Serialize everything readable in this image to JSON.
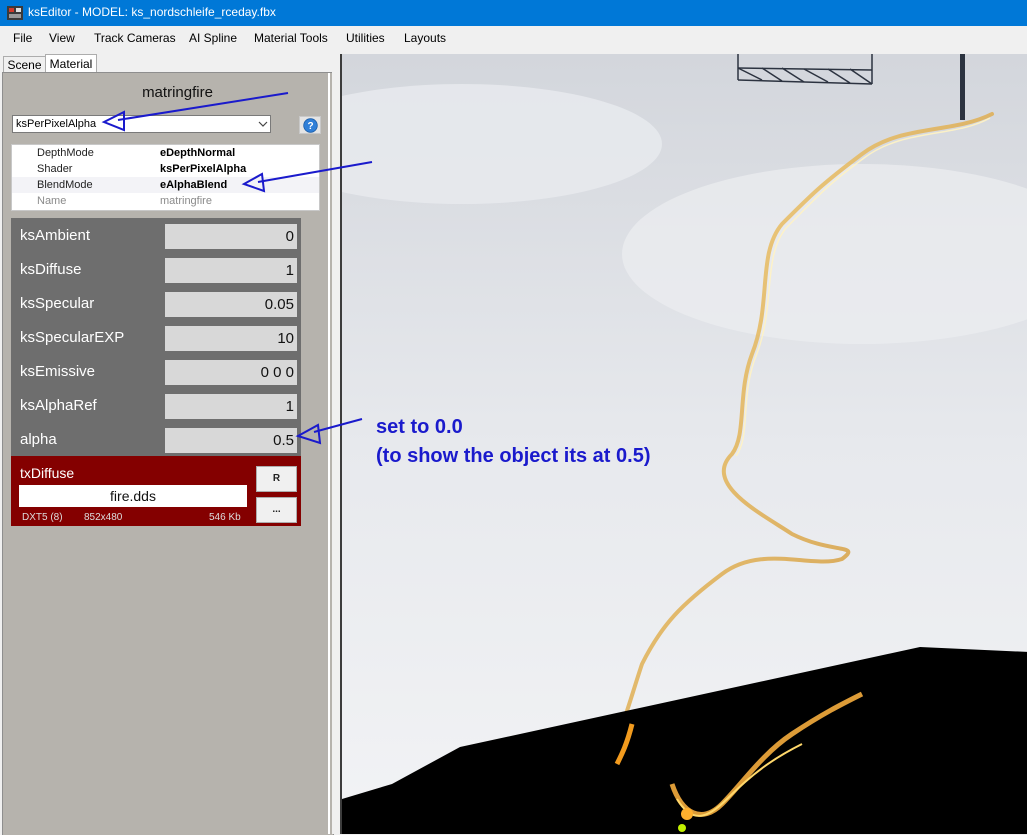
{
  "window": {
    "title": "ksEditor - MODEL: ks_nordschleife_rceday.fbx"
  },
  "menu": [
    "File",
    "View",
    "Track Cameras",
    "AI Spline",
    "Material Tools",
    "Utilities",
    "Layouts"
  ],
  "tabs": {
    "scene": "Scene",
    "material": "Material"
  },
  "material": {
    "name": "matringfire",
    "shader_selected": "ksPerPixelAlpha",
    "properties": [
      {
        "key": "DepthMode",
        "value": "eDepthNormal"
      },
      {
        "key": "Shader",
        "value": "ksPerPixelAlpha"
      },
      {
        "key": "BlendMode",
        "value": "eAlphaBlend"
      },
      {
        "key": "Name",
        "value": "matringfire"
      }
    ],
    "params": [
      {
        "label": "ksAmbient",
        "value": "0"
      },
      {
        "label": "ksDiffuse",
        "value": "1"
      },
      {
        "label": "ksSpecular",
        "value": "0.05"
      },
      {
        "label": "ksSpecularEXP",
        "value": "10"
      },
      {
        "label": "ksEmissive",
        "value": "0 0 0"
      },
      {
        "label": "ksAlphaRef",
        "value": "1"
      },
      {
        "label": "alpha",
        "value": "0.5"
      }
    ],
    "texture": {
      "label": "txDiffuse",
      "file": "fire.dds",
      "format": "DXT5 (8)",
      "size": "852x480",
      "filesize": "546 Kb",
      "reload_label": "R",
      "browse_label": "..."
    }
  },
  "annotation": {
    "line1": "set to 0.0",
    "line2": "(to show the object its at 0.5)"
  },
  "colors": {
    "titlebar": "#0078d7",
    "params_bg": "#6e6e6e",
    "texture_bg": "#840000",
    "annotation": "#1a1acc"
  },
  "icons": [
    "app-icon",
    "chevron-down-icon",
    "help-icon"
  ]
}
